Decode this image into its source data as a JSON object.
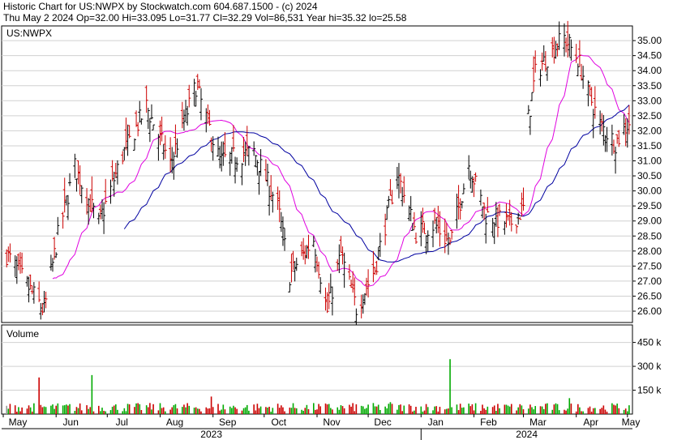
{
  "header": {
    "line1": "Historic Chart for US:NWPX by Stockwatch.com 604.687.1500 - (c) 2024",
    "line2": "Thu May  2 2024  Op=32.00  Hi=33.095  Lo=31.77  Cl=32.29  Vol=86,531  Year hi=35.32  lo=25.58"
  },
  "chart_data": {
    "type": "ohlc",
    "symbol_label": "US:NWPX",
    "price_axis": {
      "range": [
        25.58,
        35.32
      ],
      "ticks": [
        "35.00",
        "34.50",
        "34.00",
        "33.50",
        "33.00",
        "32.50",
        "32.00",
        "31.50",
        "31.00",
        "30.50",
        "30.00",
        "29.50",
        "29.00",
        "28.50",
        "28.00",
        "27.50",
        "27.00",
        "26.50",
        "26.00"
      ]
    },
    "volume_panel": {
      "label": "Volume",
      "ticks": [
        {
          "value": 450000,
          "label": "450 k"
        },
        {
          "value": 300000,
          "label": "300 k"
        },
        {
          "value": 150000,
          "label": "150 k"
        }
      ]
    },
    "x_axis": {
      "months": [
        "May",
        "Jun",
        "Jul",
        "Aug",
        "Sep",
        "Oct",
        "Nov",
        "Dec",
        "Jan",
        "Feb",
        "Mar",
        "Apr",
        "May"
      ],
      "years": [
        "2023",
        "2024"
      ]
    },
    "key_points": [
      {
        "date": "2023-05-03",
        "close": 27.9
      },
      {
        "date": "2023-05-25",
        "close": 26.0
      },
      {
        "date": "2023-06-02",
        "close": 28.5
      },
      {
        "date": "2023-06-12",
        "close": 30.8
      },
      {
        "date": "2023-06-26",
        "close": 28.9
      },
      {
        "date": "2023-07-10",
        "close": 31.2
      },
      {
        "date": "2023-07-24",
        "close": 32.8
      },
      {
        "date": "2023-08-07",
        "close": 30.9
      },
      {
        "date": "2023-08-22",
        "close": 33.5
      },
      {
        "date": "2023-09-05",
        "close": 31.0
      },
      {
        "date": "2023-09-25",
        "close": 31.3
      },
      {
        "date": "2023-10-09",
        "close": 29.5
      },
      {
        "date": "2023-10-16",
        "close": 27.2
      },
      {
        "date": "2023-10-30",
        "close": 28.4
      },
      {
        "date": "2023-11-07",
        "close": 26.0
      },
      {
        "date": "2023-11-15",
        "close": 27.9
      },
      {
        "date": "2023-11-24",
        "close": 26.1
      },
      {
        "date": "2023-12-05",
        "close": 27.4
      },
      {
        "date": "2023-12-18",
        "close": 30.6
      },
      {
        "date": "2023-12-29",
        "close": 28.6
      },
      {
        "date": "2024-01-09",
        "close": 28.9
      },
      {
        "date": "2024-01-18",
        "close": 28.2
      },
      {
        "date": "2024-01-29",
        "close": 30.9
      },
      {
        "date": "2024-02-08",
        "close": 29.2
      },
      {
        "date": "2024-02-22",
        "close": 28.9
      },
      {
        "date": "2024-03-01",
        "close": 29.4
      },
      {
        "date": "2024-03-04",
        "close": 32.4
      },
      {
        "date": "2024-03-08",
        "close": 33.9
      },
      {
        "date": "2024-03-18",
        "close": 34.7
      },
      {
        "date": "2024-03-25",
        "close": 35.1
      },
      {
        "date": "2024-04-02",
        "close": 34.4
      },
      {
        "date": "2024-04-08",
        "close": 33.3
      },
      {
        "date": "2024-04-15",
        "close": 32.2
      },
      {
        "date": "2024-04-24",
        "close": 31.6
      },
      {
        "date": "2024-05-02",
        "close": 32.29
      }
    ],
    "volume_spikes": [
      {
        "date": "2023-05-22",
        "value": 230000
      },
      {
        "date": "2023-06-23",
        "value": 245000
      },
      {
        "date": "2023-09-01",
        "value": 110000
      },
      {
        "date": "2023-12-15",
        "value": 75000
      },
      {
        "date": "2024-01-19",
        "value": 345000
      },
      {
        "date": "2024-03-29",
        "value": 100000
      }
    ],
    "series": [
      {
        "color": "#e000e0"
      },
      {
        "color": "#0000a0"
      }
    ],
    "colors": {
      "up": "#000000",
      "down": "#cc0000",
      "vol_up": "#00aa00",
      "vol_down": "#cc0000",
      "vol_flat": "#999999"
    }
  }
}
